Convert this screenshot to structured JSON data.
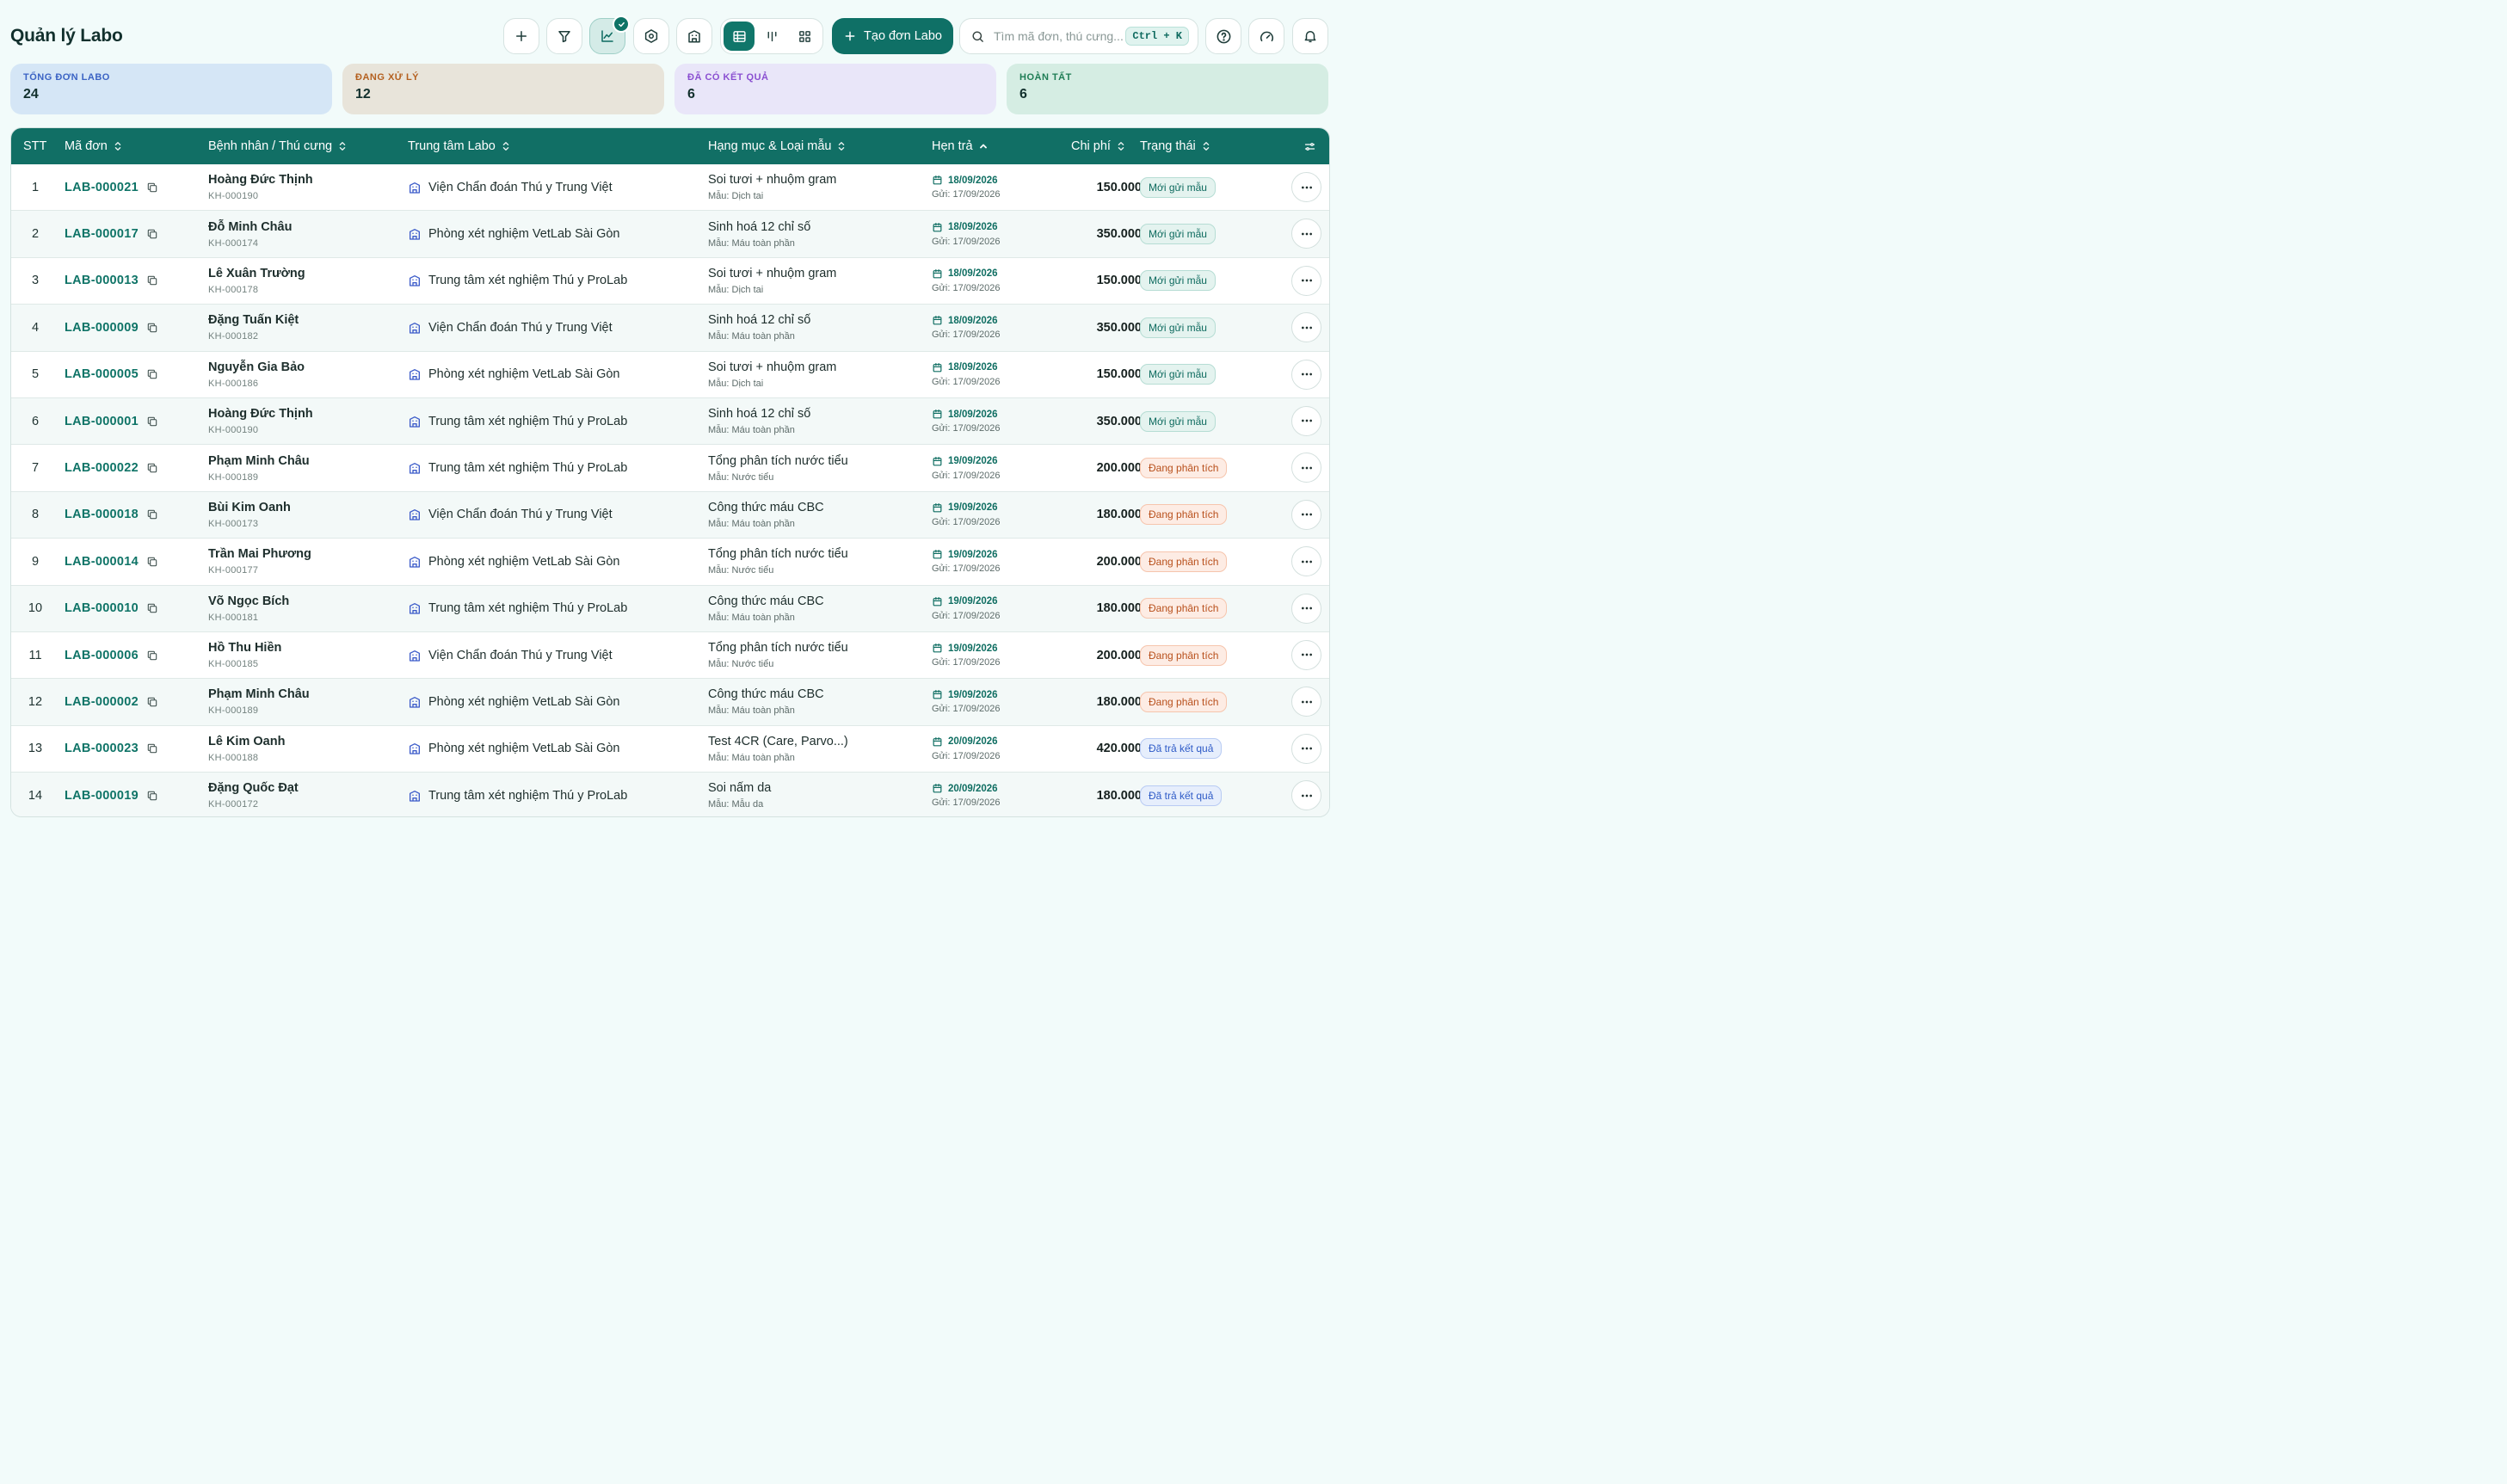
{
  "page": {
    "title": "Quản lý Labo"
  },
  "toolbar": {
    "icons": [
      "plus-icon",
      "filter-icon",
      "chart-icon",
      "settings-icon",
      "building-icon",
      "calendar-icon",
      "gauge-icon",
      "bell-icon",
      "help-icon"
    ],
    "views": [
      "table-view",
      "kanban-view",
      "grid-view"
    ],
    "active_view": "table-view",
    "create_label": "Tạo đơn Labo",
    "search_placeholder": "Tìm mã đơn, thú cưng...",
    "search_shortcut": "Ctrl + K"
  },
  "stats": [
    {
      "label": "Tổng đơn Labo",
      "value": "24",
      "color": "#3b63c4",
      "bg": "#d5e6f6"
    },
    {
      "label": "Đang xử lý",
      "value": "12",
      "color": "#b4601f",
      "bg": "#e8e4da"
    },
    {
      "label": "Đã có kết quả",
      "value": "6",
      "color": "#8a4fd1",
      "bg": "#e9e6f9"
    },
    {
      "label": "Hoàn tất",
      "value": "6",
      "color": "#1e7d55",
      "bg": "#d5ede3"
    }
  ],
  "table": {
    "columns": {
      "stt": "STT",
      "code": "Mã đơn",
      "patient": "Bệnh nhân / Thú cưng",
      "lab": "Trung tâm Labo",
      "category": "Hạng mục & Loại mẫu",
      "due": "Hẹn trả",
      "cost": "Chi phí",
      "status": "Trạng thái"
    },
    "sorted_column": "due",
    "rows": [
      {
        "stt": "1",
        "code": "LAB-000021",
        "name": "Hoàng Đức Thịnh",
        "pid": "KH-000190",
        "lab": "Viện Chẩn đoán Thú y Trung Việt",
        "category": "Soi tươi + nhuộm gram",
        "sample": "Mẫu: Dịch tai",
        "due": "18/09/2026",
        "sent": "Gửi: 17/09/2026",
        "cost": "150.000",
        "status": "Mới gửi mẫu",
        "status_type": "new"
      },
      {
        "stt": "2",
        "code": "LAB-000017",
        "name": "Đỗ Minh Châu",
        "pid": "KH-000174",
        "lab": "Phòng xét nghiệm VetLab Sài Gòn",
        "category": "Sinh hoá 12 chỉ số",
        "sample": "Mẫu: Máu toàn phần",
        "due": "18/09/2026",
        "sent": "Gửi: 17/09/2026",
        "cost": "350.000",
        "status": "Mới gửi mẫu",
        "status_type": "new"
      },
      {
        "stt": "3",
        "code": "LAB-000013",
        "name": "Lê Xuân Trường",
        "pid": "KH-000178",
        "lab": "Trung tâm xét nghiệm Thú y ProLab",
        "category": "Soi tươi + nhuộm gram",
        "sample": "Mẫu: Dịch tai",
        "due": "18/09/2026",
        "sent": "Gửi: 17/09/2026",
        "cost": "150.000",
        "status": "Mới gửi mẫu",
        "status_type": "new"
      },
      {
        "stt": "4",
        "code": "LAB-000009",
        "name": "Đặng Tuấn Kiệt",
        "pid": "KH-000182",
        "lab": "Viện Chẩn đoán Thú y Trung Việt",
        "category": "Sinh hoá 12 chỉ số",
        "sample": "Mẫu: Máu toàn phần",
        "due": "18/09/2026",
        "sent": "Gửi: 17/09/2026",
        "cost": "350.000",
        "status": "Mới gửi mẫu",
        "status_type": "new"
      },
      {
        "stt": "5",
        "code": "LAB-000005",
        "name": "Nguyễn Gia Bảo",
        "pid": "KH-000186",
        "lab": "Phòng xét nghiệm VetLab Sài Gòn",
        "category": "Soi tươi + nhuộm gram",
        "sample": "Mẫu: Dịch tai",
        "due": "18/09/2026",
        "sent": "Gửi: 17/09/2026",
        "cost": "150.000",
        "status": "Mới gửi mẫu",
        "status_type": "new"
      },
      {
        "stt": "6",
        "code": "LAB-000001",
        "name": "Hoàng Đức Thịnh",
        "pid": "KH-000190",
        "lab": "Trung tâm xét nghiệm Thú y ProLab",
        "category": "Sinh hoá 12 chỉ số",
        "sample": "Mẫu: Máu toàn phần",
        "due": "18/09/2026",
        "sent": "Gửi: 17/09/2026",
        "cost": "350.000",
        "status": "Mới gửi mẫu",
        "status_type": "new"
      },
      {
        "stt": "7",
        "code": "LAB-000022",
        "name": "Phạm Minh Châu",
        "pid": "KH-000189",
        "lab": "Trung tâm xét nghiệm Thú y ProLab",
        "category": "Tổng phân tích nước tiểu",
        "sample": "Mẫu: Nước tiểu",
        "due": "19/09/2026",
        "sent": "Gửi: 17/09/2026",
        "cost": "200.000",
        "status": "Đang phân tích",
        "status_type": "proc"
      },
      {
        "stt": "8",
        "code": "LAB-000018",
        "name": "Bùi Kim Oanh",
        "pid": "KH-000173",
        "lab": "Viện Chẩn đoán Thú y Trung Việt",
        "category": "Công thức máu CBC",
        "sample": "Mẫu: Máu toàn phần",
        "due": "19/09/2026",
        "sent": "Gửi: 17/09/2026",
        "cost": "180.000",
        "status": "Đang phân tích",
        "status_type": "proc"
      },
      {
        "stt": "9",
        "code": "LAB-000014",
        "name": "Trần Mai Phương",
        "pid": "KH-000177",
        "lab": "Phòng xét nghiệm VetLab Sài Gòn",
        "category": "Tổng phân tích nước tiểu",
        "sample": "Mẫu: Nước tiểu",
        "due": "19/09/2026",
        "sent": "Gửi: 17/09/2026",
        "cost": "200.000",
        "status": "Đang phân tích",
        "status_type": "proc"
      },
      {
        "stt": "10",
        "code": "LAB-000010",
        "name": "Võ Ngọc Bích",
        "pid": "KH-000181",
        "lab": "Trung tâm xét nghiệm Thú y ProLab",
        "category": "Công thức máu CBC",
        "sample": "Mẫu: Máu toàn phần",
        "due": "19/09/2026",
        "sent": "Gửi: 17/09/2026",
        "cost": "180.000",
        "status": "Đang phân tích",
        "status_type": "proc"
      },
      {
        "stt": "11",
        "code": "LAB-000006",
        "name": "Hồ Thu Hiền",
        "pid": "KH-000185",
        "lab": "Viện Chẩn đoán Thú y Trung Việt",
        "category": "Tổng phân tích nước tiểu",
        "sample": "Mẫu: Nước tiểu",
        "due": "19/09/2026",
        "sent": "Gửi: 17/09/2026",
        "cost": "200.000",
        "status": "Đang phân tích",
        "status_type": "proc"
      },
      {
        "stt": "12",
        "code": "LAB-000002",
        "name": "Phạm Minh Châu",
        "pid": "KH-000189",
        "lab": "Phòng xét nghiệm VetLab Sài Gòn",
        "category": "Công thức máu CBC",
        "sample": "Mẫu: Máu toàn phần",
        "due": "19/09/2026",
        "sent": "Gửi: 17/09/2026",
        "cost": "180.000",
        "status": "Đang phân tích",
        "status_type": "proc"
      },
      {
        "stt": "13",
        "code": "LAB-000023",
        "name": "Lê Kim Oanh",
        "pid": "KH-000188",
        "lab": "Phòng xét nghiệm VetLab Sài Gòn",
        "category": "Test 4CR (Care, Parvo...)",
        "sample": "Mẫu: Máu toàn phần",
        "due": "20/09/2026",
        "sent": "Gửi: 17/09/2026",
        "cost": "420.000",
        "status": "Đã trả kết quả",
        "status_type": "done"
      },
      {
        "stt": "14",
        "code": "LAB-000019",
        "name": "Đặng Quốc Đạt",
        "pid": "KH-000172",
        "lab": "Trung tâm xét nghiệm Thú y ProLab",
        "category": "Soi nấm da",
        "sample": "Mẫu: Mẫu da",
        "due": "20/09/2026",
        "sent": "Gửi: 17/09/2026",
        "cost": "180.000",
        "status": "Đã trả kết quả",
        "status_type": "done"
      }
    ]
  }
}
